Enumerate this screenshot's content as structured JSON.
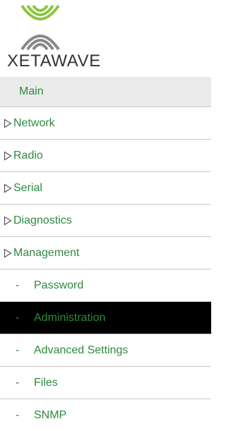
{
  "brand": {
    "logo_text": "XETAWAVE",
    "icon": "xetawave-logo-icon"
  },
  "colors": {
    "link_green": "#2e8a40",
    "active_bg": "#000000",
    "main_bg": "#ebebeb",
    "divider": "#c8c8c8"
  },
  "menu": {
    "main": "Main",
    "groups": [
      {
        "label": "Network",
        "icon": "collapsed-triangle-icon"
      },
      {
        "label": "Radio",
        "icon": "collapsed-triangle-icon"
      },
      {
        "label": "Serial",
        "icon": "collapsed-triangle-icon"
      },
      {
        "label": "Diagnostics",
        "icon": "collapsed-triangle-icon"
      },
      {
        "label": "Management",
        "icon": "collapsed-triangle-icon"
      }
    ],
    "sub_prefix": "-",
    "subitems": [
      {
        "label": "Password",
        "active": false
      },
      {
        "label": "Administration",
        "active": true
      },
      {
        "label": "Advanced Settings",
        "active": false
      },
      {
        "label": "Files",
        "active": false
      },
      {
        "label": "SNMP",
        "active": false
      }
    ]
  }
}
